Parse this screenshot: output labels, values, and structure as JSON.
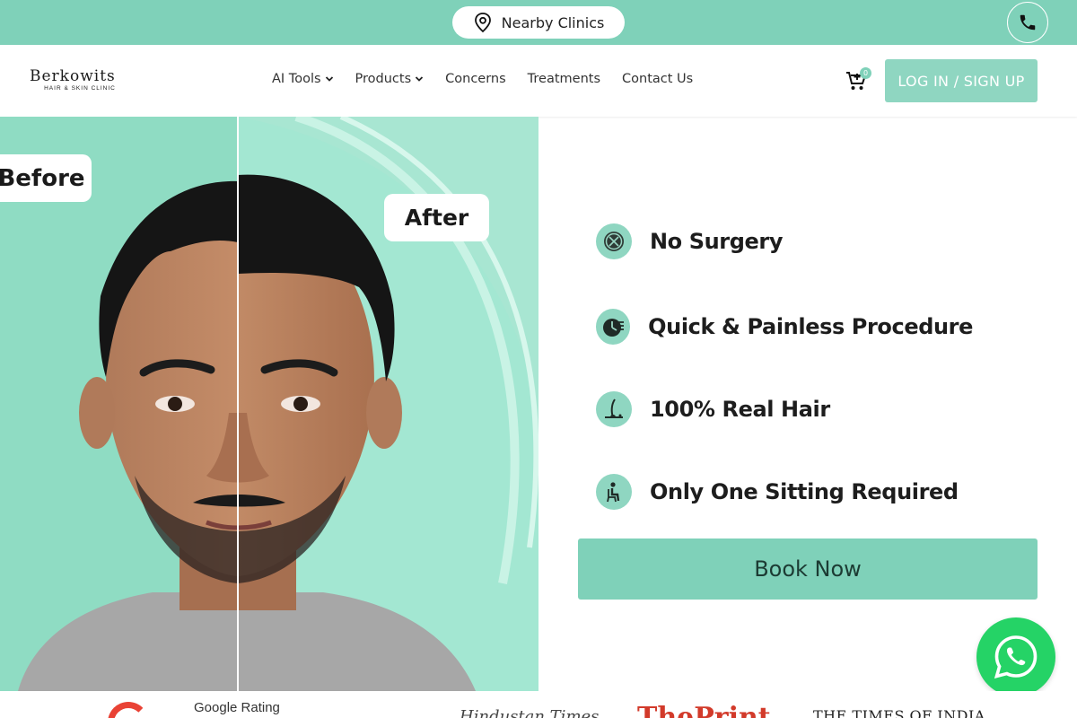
{
  "topbar": {
    "nearby_label": "Nearby Clinics",
    "bg_color": "#7fd1b9"
  },
  "brand": {
    "name": "Berkowits",
    "tagline": "HAIR & SKIN CLINIC"
  },
  "nav": {
    "items": [
      {
        "label": "AI Tools",
        "has_dropdown": true
      },
      {
        "label": "Products",
        "has_dropdown": true
      },
      {
        "label": "Concerns",
        "has_dropdown": false
      },
      {
        "label": "Treatments",
        "has_dropdown": false
      },
      {
        "label": "Contact Us",
        "has_dropdown": false
      }
    ],
    "cart_count": "0",
    "login_label": "LOG IN / SIGN UP"
  },
  "hero": {
    "before_label": "Before",
    "after_label": "After",
    "benefits": [
      {
        "icon": "no-scalpel-icon",
        "label": "No Surgery"
      },
      {
        "icon": "timer-icon",
        "label": "Quick & Painless Procedure"
      },
      {
        "icon": "hair-strand-icon",
        "label": "100% Real Hair"
      },
      {
        "icon": "seated-person-icon",
        "label": "Only One Sitting Required"
      }
    ],
    "cta_label": "Book Now"
  },
  "strip": {
    "google_rating_label": "Google Rating",
    "press": [
      "Hindustan Times",
      "ThePrint",
      "THE TIMES OF INDIA"
    ]
  },
  "colors": {
    "accent": "#7fd1b9",
    "accent_light": "#8fd6c1",
    "whatsapp": "#25d366"
  }
}
